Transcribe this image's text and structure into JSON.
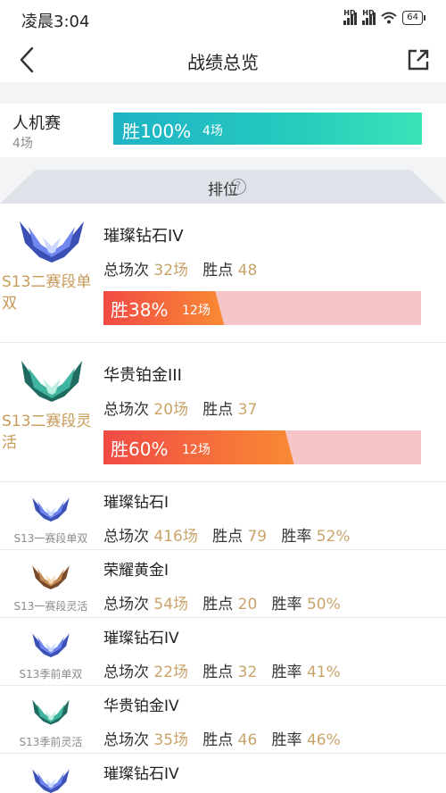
{
  "status": {
    "time": "凌晨3:04",
    "signal1": "HD",
    "signal2": "HD",
    "battery": "64"
  },
  "nav": {
    "title": "战绩总览"
  },
  "pve": {
    "name": "人机赛",
    "count": "4场",
    "rate": "胜100%",
    "games": "4场",
    "win_fraction": 1.0
  },
  "ranked": {
    "title": "排位",
    "help": "?",
    "label_total": "总场次",
    "label_points": "胜点",
    "label_rate": "胜率",
    "seasons": [
      {
        "season": "S13二赛段单双",
        "tier": "璀璨钻石IV",
        "total": "32场",
        "points": "48",
        "rate": "胜38%",
        "games": "12场",
        "win_fraction": 0.38,
        "emblem": "diamond"
      },
      {
        "season": "S13二赛段灵活",
        "tier": "华贵铂金III",
        "total": "20场",
        "points": "37",
        "rate": "胜60%",
        "games": "12场",
        "win_fraction": 0.6,
        "emblem": "platinum"
      },
      {
        "season": "S13一赛段单双",
        "tier": "璀璨钻石I",
        "total": "416场",
        "points": "79",
        "winrate": "52%",
        "emblem": "diamond"
      },
      {
        "season": "S13一赛段灵活",
        "tier": "荣耀黄金I",
        "total": "54场",
        "points": "20",
        "winrate": "50%",
        "emblem": "gold"
      },
      {
        "season": "S13季前单双",
        "tier": "璀璨钻石IV",
        "total": "22场",
        "points": "32",
        "winrate": "41%",
        "emblem": "diamond"
      },
      {
        "season": "S13季前灵活",
        "tier": "华贵铂金IV",
        "total": "35场",
        "points": "46",
        "winrate": "46%",
        "emblem": "platinum"
      },
      {
        "tier": "璀璨钻石IV",
        "emblem": "diamond"
      }
    ]
  },
  "colors": {
    "accent_gold": "#c79a59",
    "pve_bar": "#25c9be",
    "lose_bar": "#f6c5c9",
    "win_bar": "#f4622f"
  }
}
